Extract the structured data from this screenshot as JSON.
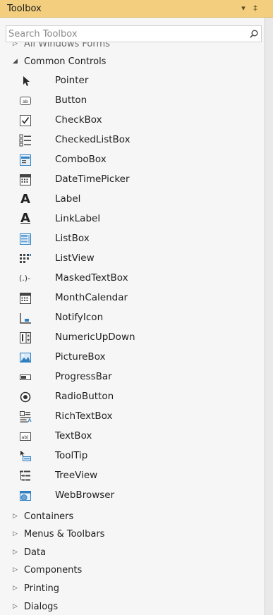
{
  "toolbox": {
    "title": "Toolbox",
    "pin_glyph": "▾",
    "pin2_glyph": "‡",
    "search_placeholder": "Search Toolbox"
  },
  "categories": {
    "all_windows_forms": "All Windows Forms",
    "common_controls": "Common Controls",
    "containers": "Containers",
    "menus_toolbars": "Menus & Toolbars",
    "data": "Data",
    "components": "Components",
    "printing": "Printing",
    "dialogs": "Dialogs"
  },
  "common_controls_items": [
    {
      "label": "Pointer",
      "icon": "pointer-icon"
    },
    {
      "label": "Button",
      "icon": "button-icon"
    },
    {
      "label": "CheckBox",
      "icon": "checkbox-icon"
    },
    {
      "label": "CheckedListBox",
      "icon": "checkedlistbox-icon"
    },
    {
      "label": "ComboBox",
      "icon": "combobox-icon"
    },
    {
      "label": "DateTimePicker",
      "icon": "datetimepicker-icon"
    },
    {
      "label": "Label",
      "icon": "label-icon"
    },
    {
      "label": "LinkLabel",
      "icon": "linklabel-icon"
    },
    {
      "label": "ListBox",
      "icon": "listbox-icon"
    },
    {
      "label": "ListView",
      "icon": "listview-icon"
    },
    {
      "label": "MaskedTextBox",
      "icon": "maskedtextbox-icon"
    },
    {
      "label": "MonthCalendar",
      "icon": "monthcalendar-icon"
    },
    {
      "label": "NotifyIcon",
      "icon": "notifyicon-icon"
    },
    {
      "label": "NumericUpDown",
      "icon": "numericupdown-icon"
    },
    {
      "label": "PictureBox",
      "icon": "picturebox-icon"
    },
    {
      "label": "ProgressBar",
      "icon": "progressbar-icon"
    },
    {
      "label": "RadioButton",
      "icon": "radiobutton-icon"
    },
    {
      "label": "RichTextBox",
      "icon": "richtextbox-icon"
    },
    {
      "label": "TextBox",
      "icon": "textbox-icon"
    },
    {
      "label": "ToolTip",
      "icon": "tooltip-icon"
    },
    {
      "label": "TreeView",
      "icon": "treeview-icon"
    },
    {
      "label": "WebBrowser",
      "icon": "webbrowser-icon"
    }
  ],
  "icon_glyphs": {
    "label_glyph": "A",
    "linklabel_glyph": "A",
    "masked_glyph": "(.)-"
  },
  "colors": {
    "title_bar": "#f3ce7e",
    "panel": "#f6f6f6",
    "icon_dark": "#3b3b3b",
    "icon_blue": "#2f7fc1"
  }
}
